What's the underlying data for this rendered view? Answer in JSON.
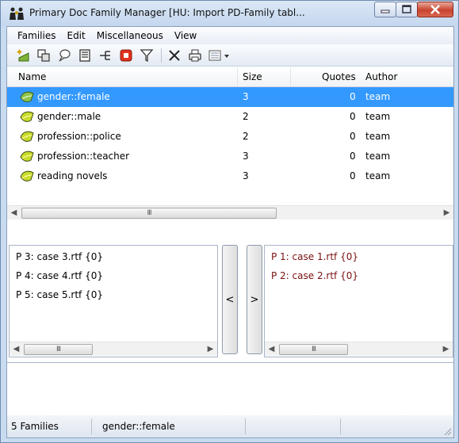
{
  "window": {
    "title": "Primary Doc Family Manager [HU: Import PD-Family tabl...",
    "minimize_icon": "minimize-icon",
    "maximize_icon": "maximize-icon",
    "close_icon": "close-icon"
  },
  "menu": [
    "Families",
    "Edit",
    "Miscellaneous",
    "View"
  ],
  "toolbar": {
    "icons": [
      "new-family-icon",
      "copy-icon",
      "comment-icon",
      "document-icon",
      "tree-icon",
      "stop-icon",
      "filter-icon",
      "delete-icon",
      "print-icon",
      "view-options-icon"
    ]
  },
  "families_table": {
    "columns": [
      "Name",
      "Size",
      "Quotes",
      "Author"
    ],
    "rows": [
      {
        "name": "gender::female",
        "size": "3",
        "quotes": "0",
        "author": "team",
        "selected": true
      },
      {
        "name": "gender::male",
        "size": "2",
        "quotes": "0",
        "author": "team",
        "selected": false
      },
      {
        "name": "profession::police",
        "size": "2",
        "quotes": "0",
        "author": "team",
        "selected": false
      },
      {
        "name": "profession::teacher",
        "size": "3",
        "quotes": "0",
        "author": "team",
        "selected": false
      },
      {
        "name": "reading novels",
        "size": "3",
        "quotes": "0",
        "author": "team",
        "selected": false
      }
    ],
    "scroll_thumb_label": "III"
  },
  "non_members": {
    "items": [
      "P 3: case 3.rtf {0}",
      "P 4: case 4.rtf {0}",
      "P 5: case 5.rtf {0}"
    ],
    "scroll_thumb_label": "III"
  },
  "members": {
    "items": [
      "P 1: case 1.rtf {0}",
      "P 2: case 2.rtf {0}"
    ],
    "scroll_thumb_label": "III",
    "color": "#7a1010"
  },
  "move_buttons": {
    "add_label": "<",
    "remove_label": ">"
  },
  "statusbar": {
    "count": "5 Families",
    "current": "gender::female"
  }
}
